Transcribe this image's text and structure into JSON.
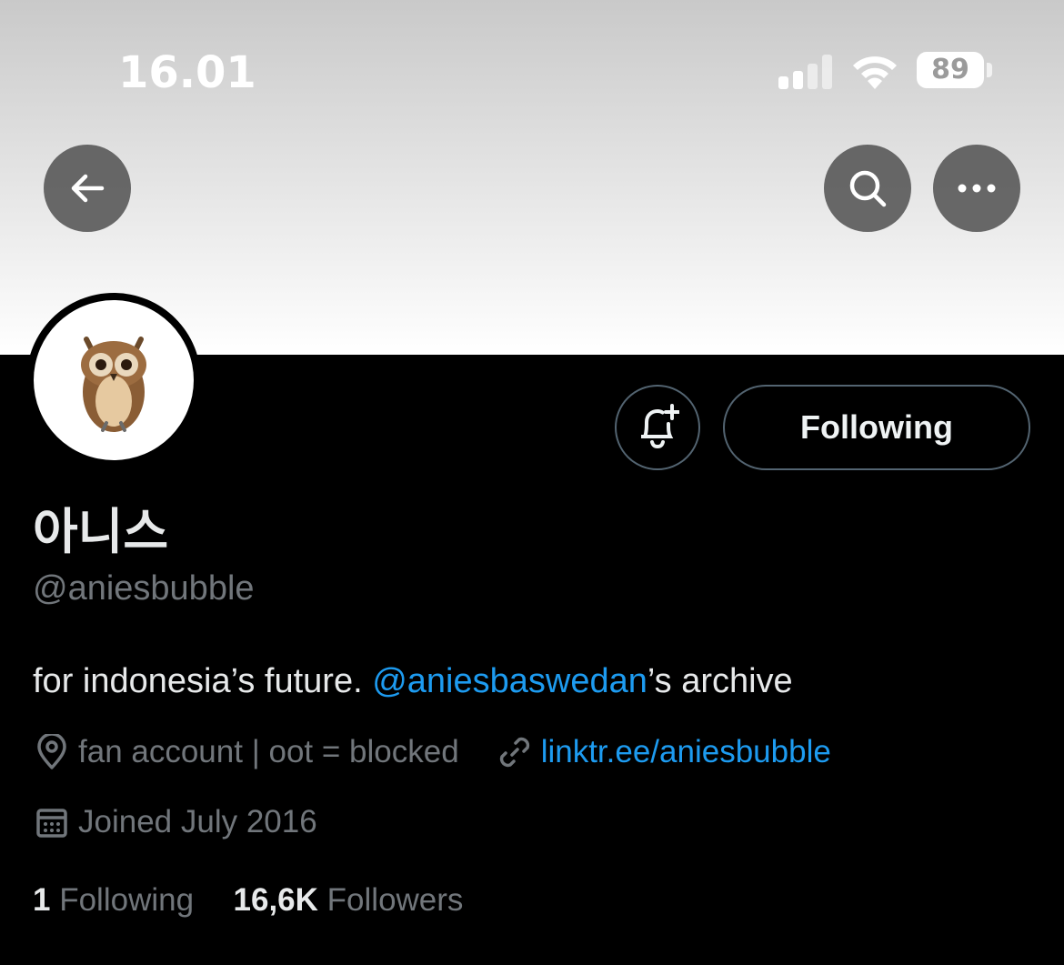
{
  "status_bar": {
    "time": "16.01",
    "battery": "89",
    "signal_icon": "cellular-signal-icon",
    "wifi_icon": "wifi-icon"
  },
  "header": {
    "back_icon": "arrow-left-icon",
    "search_icon": "search-icon",
    "more_icon": "more-horizontal-icon"
  },
  "profile": {
    "avatar_icon": "owl-avatar",
    "display_name": "아니스",
    "handle": "@aniesbubble",
    "bio_prefix": "for indonesia’s future. ",
    "bio_mention": "@aniesbaswedan",
    "bio_suffix": "’s archive",
    "location": "fan account | oot = blocked",
    "website": "linktr.ee/aniesbubble",
    "joined": "Joined July 2016",
    "following_count": "1",
    "following_label": "Following",
    "followers_count": "16,6K",
    "followers_label": "Followers"
  },
  "actions": {
    "notify_icon": "bell-plus-icon",
    "following_button": "Following"
  },
  "colors": {
    "accent": "#1d9bf0",
    "background": "#000000",
    "muted_text": "#71767b",
    "primary_text": "#e7e9ea"
  }
}
